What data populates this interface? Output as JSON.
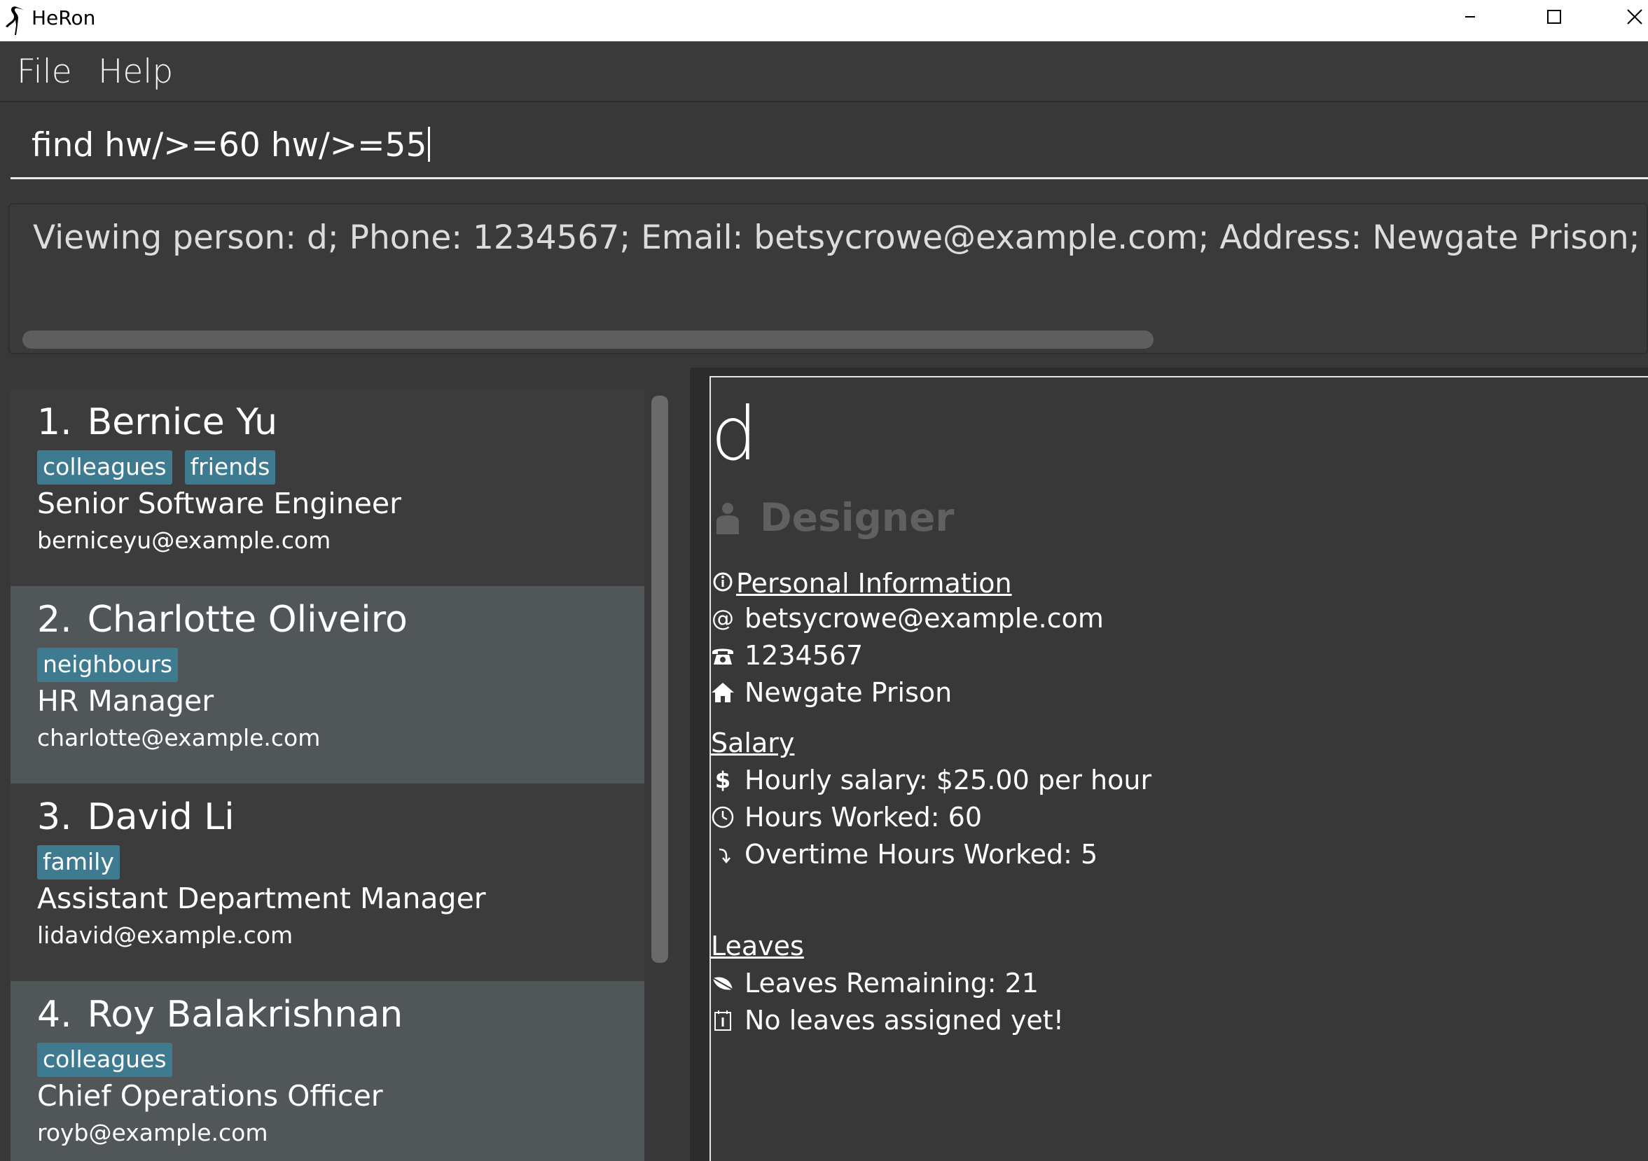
{
  "window": {
    "title": "HeRon"
  },
  "menu": {
    "file": "File",
    "help": "Help"
  },
  "command": {
    "value": "find hw/>=60 hw/>=55"
  },
  "result": {
    "text": "Viewing person: d; Phone: 1234567; Email: betsycrowe@example.com; Address: Newgate Prison; Role: Designer; Leaves"
  },
  "persons": [
    {
      "index": "1.",
      "name": "Bernice Yu",
      "tags": [
        "colleagues",
        "friends"
      ],
      "role": "Senior Software Engineer",
      "email": "berniceyu@example.com"
    },
    {
      "index": "2.",
      "name": "Charlotte Oliveiro",
      "tags": [
        "neighbours"
      ],
      "role": "HR Manager",
      "email": "charlotte@example.com"
    },
    {
      "index": "3.",
      "name": "David Li",
      "tags": [
        "family"
      ],
      "role": "Assistant Department Manager",
      "email": "lidavid@example.com"
    },
    {
      "index": "4.",
      "name": "Roy Balakrishnan",
      "tags": [
        "colleagues"
      ],
      "role": "Chief Operations Officer",
      "email": "royb@example.com"
    }
  ],
  "detail": {
    "name": "d",
    "role": "Designer",
    "personal_title": "Personal Information",
    "email": "betsycrowe@example.com",
    "phone": "1234567",
    "address": "Newgate Prison",
    "salary_title": "Salary",
    "hourly_salary": "Hourly salary: $25.00 per hour",
    "hours_worked": "Hours Worked: 60",
    "overtime": "Overtime Hours Worked: 5",
    "leaves_title": "Leaves",
    "leaves_remaining": "Leaves Remaining: 21",
    "no_leaves": "No leaves assigned yet!",
    "icons": {
      "info": "info-circle-icon",
      "email": "at-icon",
      "phone": "telephone-icon",
      "address": "house-icon",
      "salary": "dollar-icon",
      "hours": "clock-icon",
      "overtime": "overtime-arrow-icon",
      "leaves": "leaf-icon",
      "no_leaves": "calendar-icon"
    }
  },
  "colors": {
    "tag": "#3e7b91",
    "background": "#383838",
    "card_alt": "#515658",
    "role_muted": "#606060"
  }
}
